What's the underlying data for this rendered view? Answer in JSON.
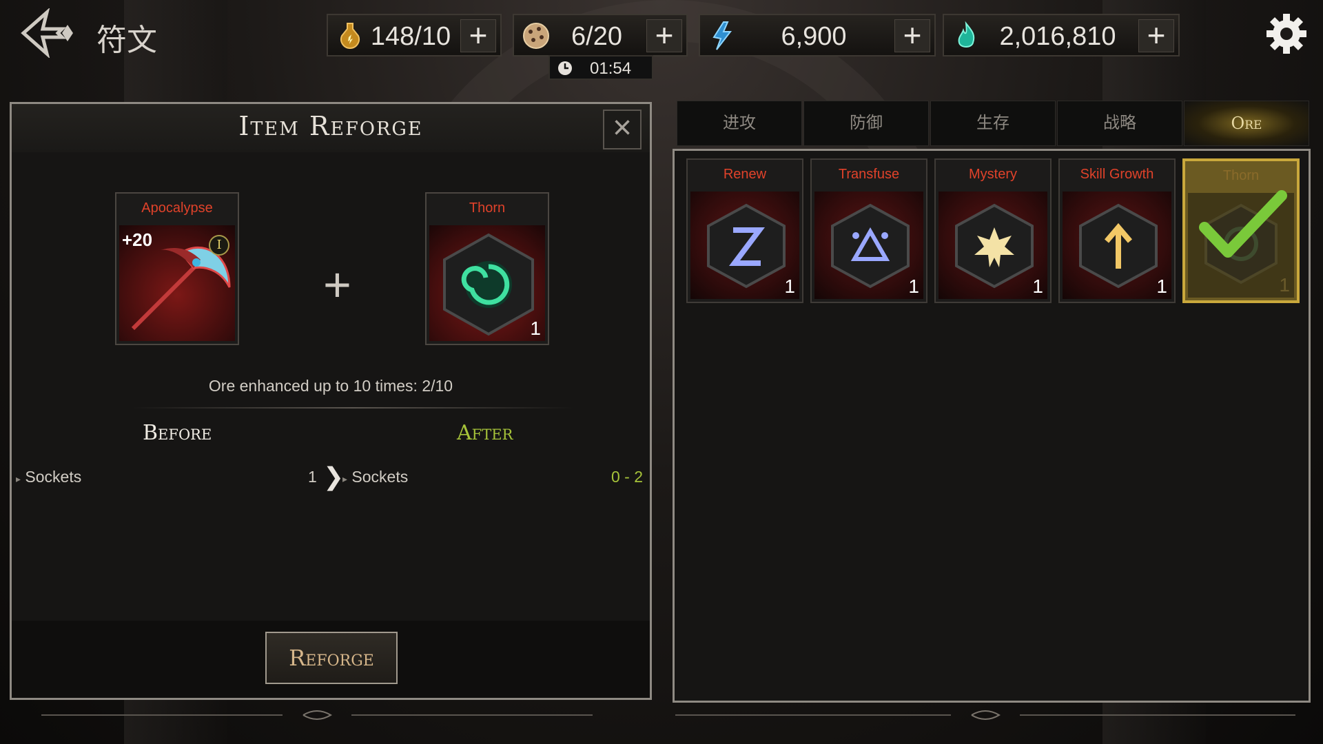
{
  "header": {
    "title": "符文",
    "resources": [
      {
        "icon": "potion-icon",
        "value": "148/10"
      },
      {
        "icon": "dice-icon",
        "value": "6/20"
      },
      {
        "icon": "crystal-icon",
        "value": "6,900"
      },
      {
        "icon": "soul-flame-icon",
        "value": "2,016,810"
      }
    ],
    "timer": "01:54"
  },
  "reforge_panel": {
    "title": "Item Reforge",
    "item": {
      "name": "Apocalypse",
      "level": "+20",
      "tier": "I"
    },
    "ore": {
      "name": "Thorn",
      "count": "1"
    },
    "enhance_text": "Ore enhanced up to 10 times: 2/10",
    "before_label": "Before",
    "after_label": "After",
    "stat_before": {
      "label": "Sockets",
      "value": "1"
    },
    "stat_after": {
      "label": "Sockets",
      "value": "0 - 2"
    },
    "reforge_button": "Reforge"
  },
  "ore_panel": {
    "tabs": [
      "进攻",
      "防御",
      "生存",
      "战略",
      "Ore"
    ],
    "active_tab": "Ore",
    "ores": [
      {
        "name": "Renew",
        "count": "1",
        "icon": "z-rune-icon"
      },
      {
        "name": "Transfuse",
        "count": "1",
        "icon": "triangle-rune-icon"
      },
      {
        "name": "Mystery",
        "count": "1",
        "icon": "star-rune-icon"
      },
      {
        "name": "Skill Growth",
        "count": "1",
        "icon": "arrow-rune-icon"
      },
      {
        "name": "Thorn",
        "count": "1",
        "icon": "spiral-rune-icon",
        "selected": true
      }
    ]
  },
  "colors": {
    "ore_name": "#e0422a",
    "after_green": "#a6c33a",
    "selected_gold": "#c9a83c"
  }
}
